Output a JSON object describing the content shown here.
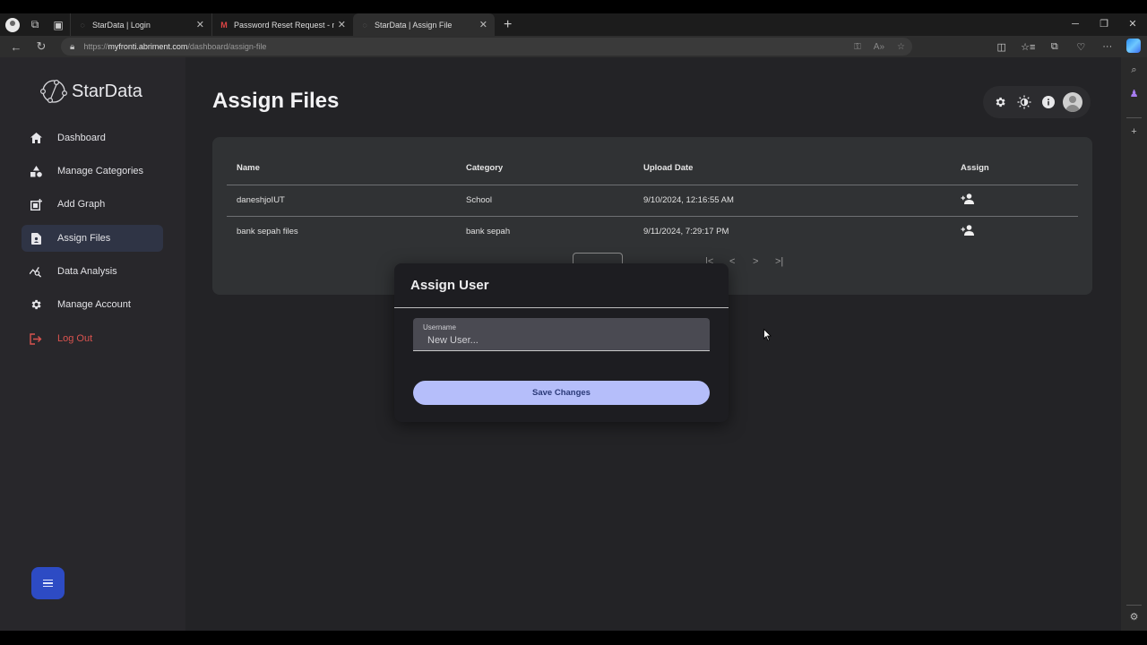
{
  "browser": {
    "tabs": [
      {
        "title": "StarData | Login",
        "favicon": "stardata-icon",
        "active": false
      },
      {
        "title": "Password Reset Request - mahdij",
        "favicon": "gmail-icon",
        "active": false
      },
      {
        "title": "StarData | Assign File",
        "favicon": "stardata-icon",
        "active": true
      }
    ],
    "new_tab": "+",
    "url_prefix": "https://",
    "url_host": "myfronti.abriment.com",
    "url_path": "/dashboard/assign-file"
  },
  "sidebar": {
    "brand": "StarData",
    "items": [
      {
        "label": "Dashboard",
        "icon": "home-icon"
      },
      {
        "label": "Manage Categories",
        "icon": "category-icon"
      },
      {
        "label": "Add Graph",
        "icon": "add-graph-icon"
      },
      {
        "label": "Assign Files",
        "icon": "assign-file-icon",
        "active": true
      },
      {
        "label": "Data Analysis",
        "icon": "data-analysis-icon"
      },
      {
        "label": "Manage Account",
        "icon": "gear-icon"
      },
      {
        "label": "Log Out",
        "icon": "logout-icon"
      }
    ]
  },
  "header": {
    "title": "Assign Files"
  },
  "table": {
    "columns": [
      "Name",
      "Category",
      "Upload Date",
      "Assign"
    ],
    "rows": [
      {
        "name": "daneshjoIUT",
        "category": "School",
        "upload_date": "9/10/2024, 12:16:55 AM"
      },
      {
        "name": "bank sepah files",
        "category": "bank sepah",
        "upload_date": "9/11/2024, 7:29:17 PM"
      }
    ],
    "pagination": {
      "first": "|<",
      "prev": "<",
      "next": ">",
      "last": ">|"
    }
  },
  "dialog": {
    "title": "Assign User",
    "field_label": "Username",
    "field_placeholder": "New User...",
    "field_value": "",
    "save_label": "Save Changes"
  },
  "colors": {
    "accent": "#b5befa",
    "active_nav": "#2f3445",
    "logout": "#d9534f",
    "fab": "#2d4bc4"
  }
}
